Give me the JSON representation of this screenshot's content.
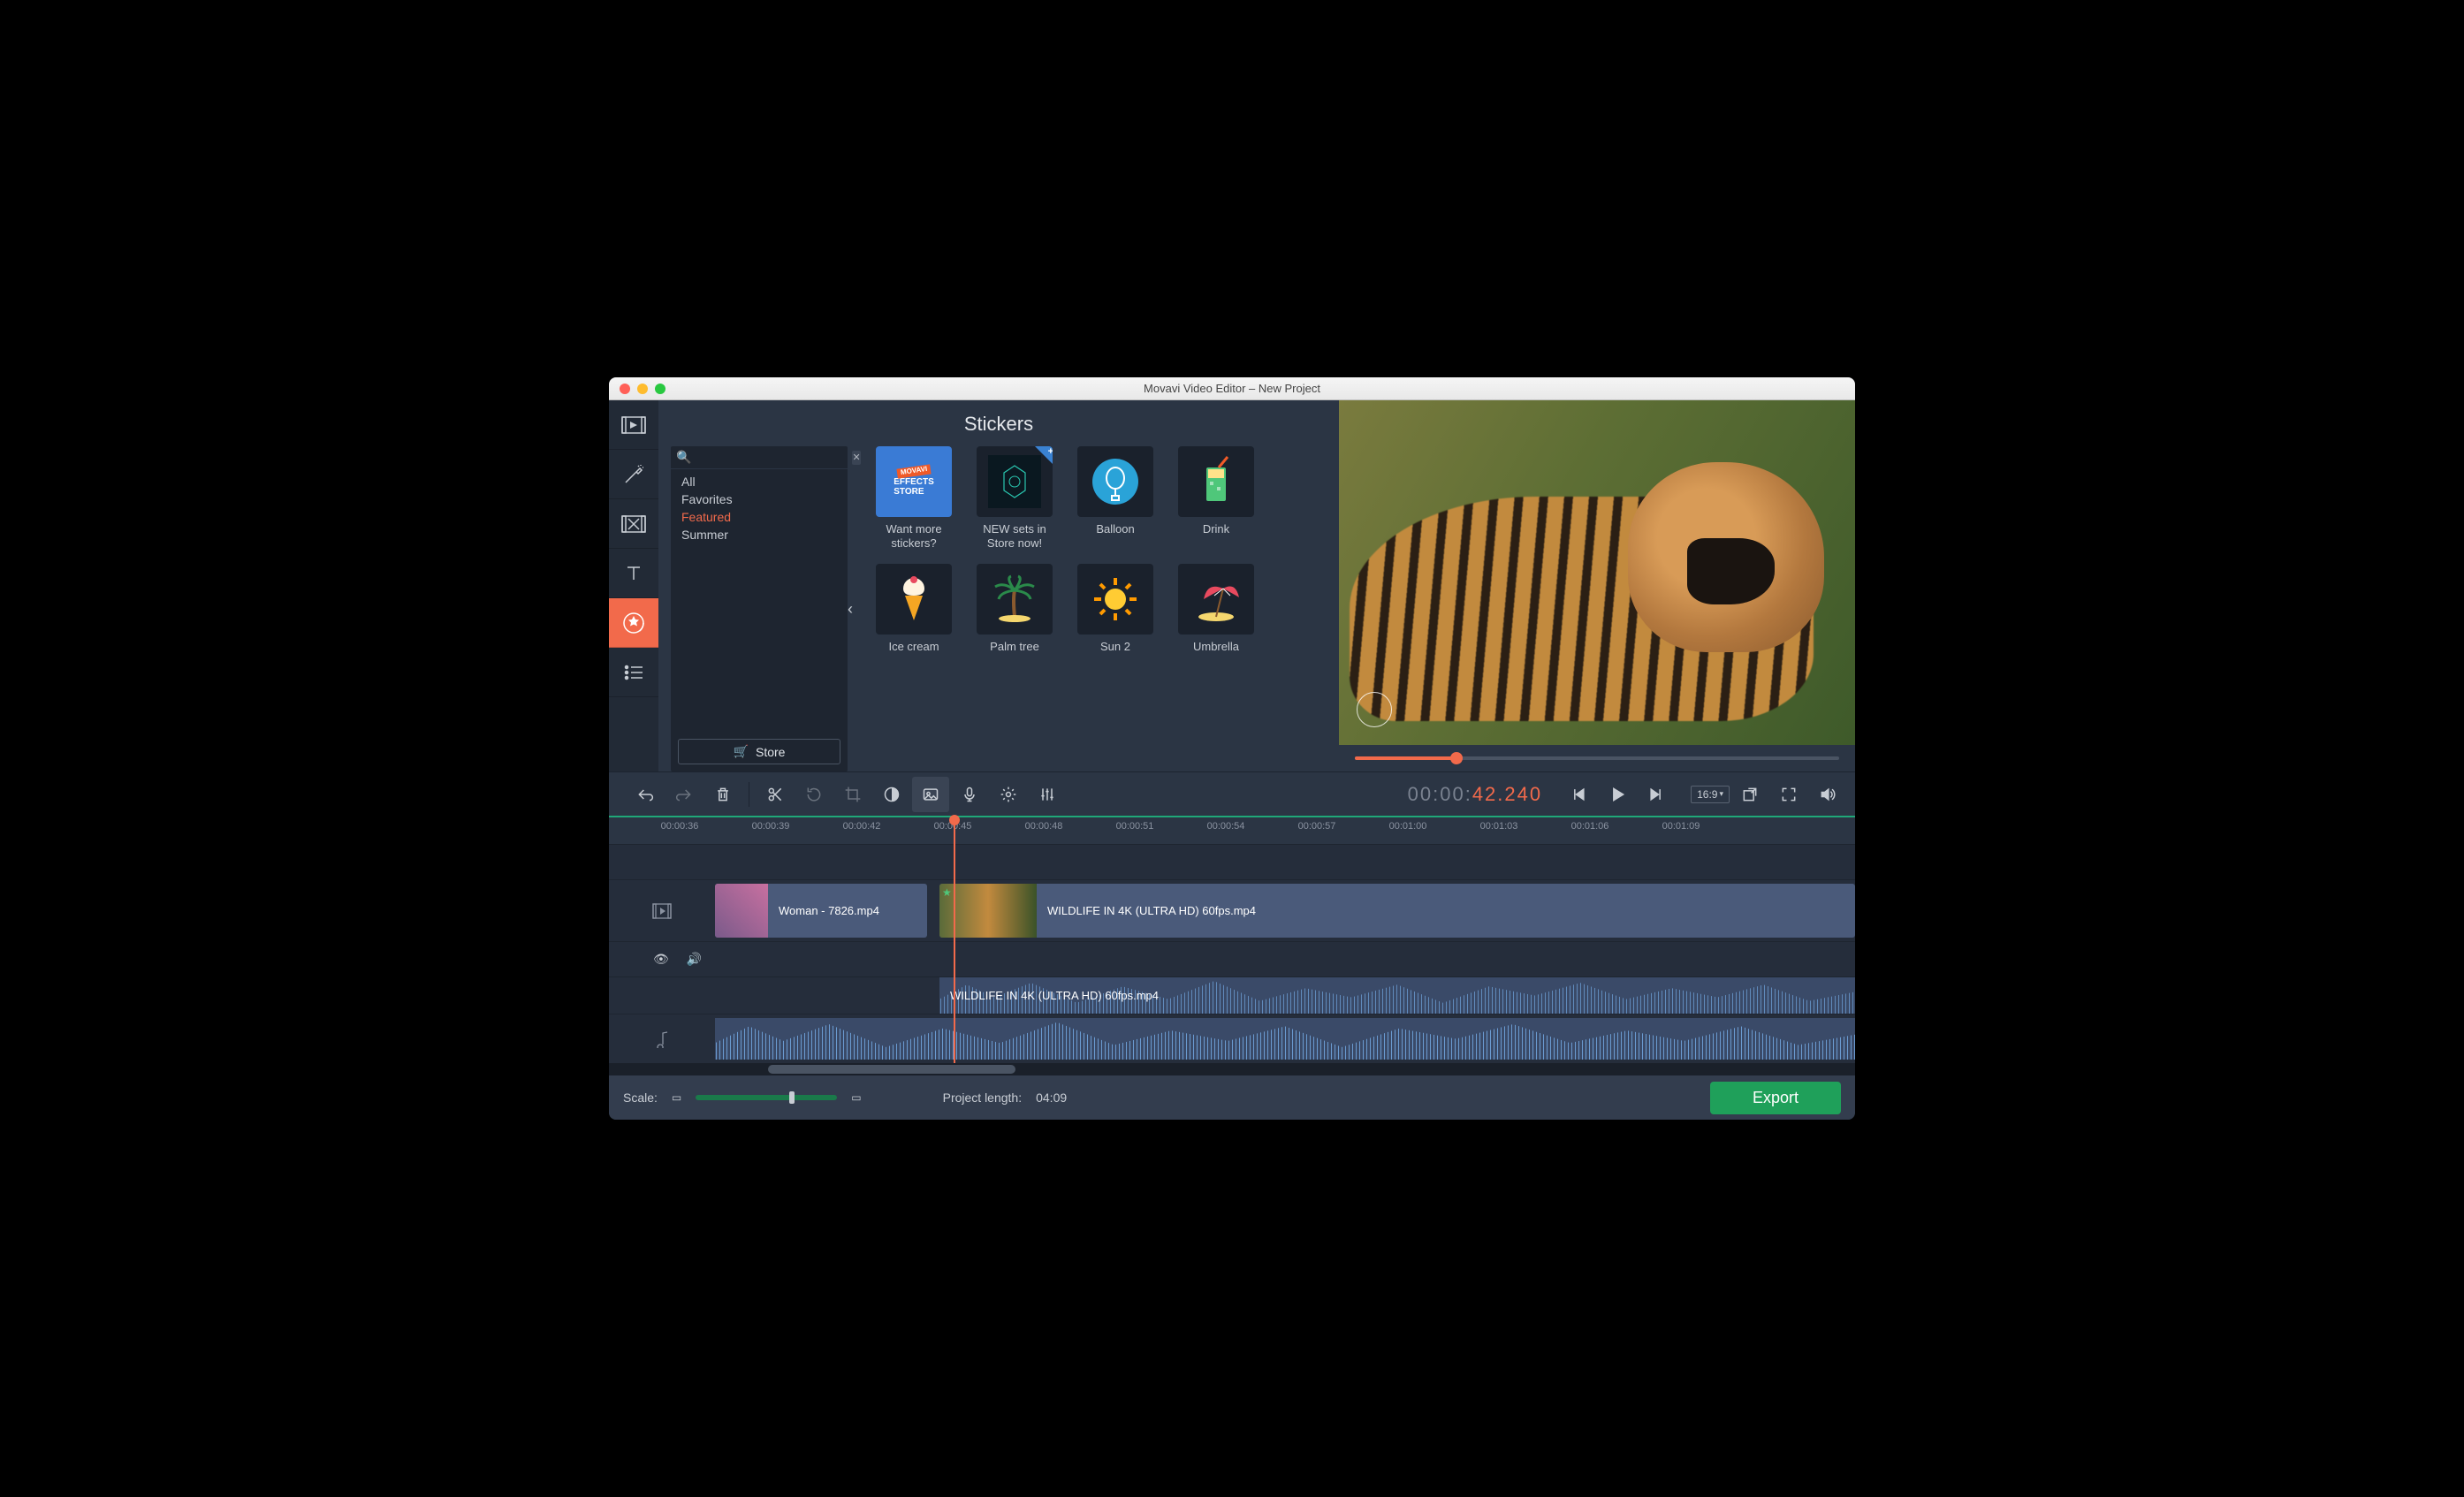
{
  "window": {
    "title": "Movavi Video Editor – New Project"
  },
  "panel": {
    "title": "Stickers",
    "store_button": "Store",
    "categories": [
      "All",
      "Favorites",
      "Featured",
      "Summer"
    ],
    "selected_category": "Featured",
    "search_placeholder": ""
  },
  "stickers": [
    {
      "label": "Want more stickers?",
      "kind": "effects-store"
    },
    {
      "label": "NEW sets in Store now!",
      "kind": "store-new",
      "badge": true
    },
    {
      "label": "Balloon",
      "kind": "balloon"
    },
    {
      "label": "Drink",
      "kind": "drink"
    },
    {
      "label": "Ice cream",
      "kind": "icecream"
    },
    {
      "label": "Palm tree",
      "kind": "palm"
    },
    {
      "label": "Sun 2",
      "kind": "sun"
    },
    {
      "label": "Umbrella",
      "kind": "umbrella"
    }
  ],
  "playback": {
    "timecode_prefix": "00:00:",
    "timecode_active": "42.240",
    "aspect": "16:9",
    "scrub_percent": 21
  },
  "ruler": {
    "ticks": [
      "00:00:36",
      "00:00:39",
      "00:00:42",
      "00:00:45",
      "00:00:48",
      "00:00:51",
      "00:00:54",
      "00:00:57",
      "00:01:00",
      "00:01:03",
      "00:01:06",
      "00:01:09"
    ]
  },
  "clips": {
    "video1_name": "Woman - 7826.mp4",
    "video2_name": "WILDLIFE IN 4K (ULTRA HD) 60fps.mp4",
    "audio1_name": "WILDLIFE IN 4K (ULTRA HD) 60fps.mp4"
  },
  "footer": {
    "scale_label": "Scale:",
    "length_label": "Project length:",
    "length_value": "04:09",
    "export_label": "Export"
  }
}
